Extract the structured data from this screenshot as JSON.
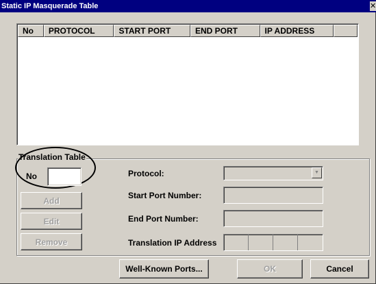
{
  "window": {
    "title": "Static IP Masquerade Table",
    "close_glyph": "✕"
  },
  "table": {
    "columns": [
      "No",
      "PROTOCOL",
      "START PORT",
      "END PORT",
      "IP ADDRESS",
      ""
    ],
    "rows": []
  },
  "translation": {
    "group_label": "Translation Table",
    "no_label": "No",
    "no_value": "",
    "add_label": "Add",
    "edit_label": "Edit",
    "remove_label": "Remove",
    "protocol_label": "Protocol:",
    "protocol_value": "",
    "start_port_label": "Start Port Number:",
    "start_port_value": "",
    "end_port_label": "End Port Number:",
    "end_port_value": "",
    "ip_label": "Translation IP Address",
    "ip_octets": [
      "",
      "",
      "",
      ""
    ]
  },
  "footer": {
    "well_known_label": "Well-Known Ports...",
    "ok_label": "OK",
    "cancel_label": "Cancel"
  }
}
